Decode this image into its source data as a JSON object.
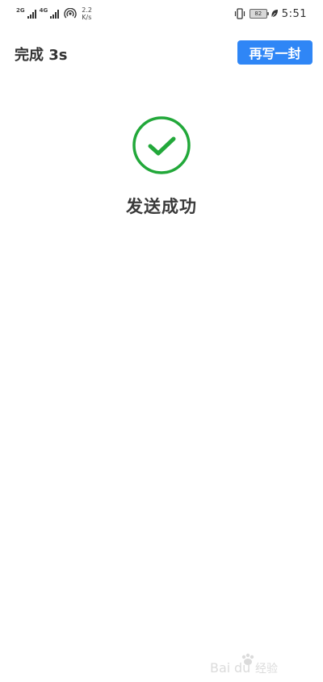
{
  "status_bar": {
    "network1": "2G",
    "network2": "4G",
    "speed_value": "2.2",
    "speed_unit": "K/s",
    "battery": "82",
    "time": "5:51"
  },
  "header": {
    "done_label": "完成 3s",
    "rewrite_label": "再写一封"
  },
  "main": {
    "success_message": "发送成功"
  },
  "colors": {
    "accent_blue": "#2f86f6",
    "success_green": "#22a83a"
  },
  "icons": {
    "success": "check-circle-icon"
  },
  "watermark": {
    "text": "Baidu经验"
  }
}
